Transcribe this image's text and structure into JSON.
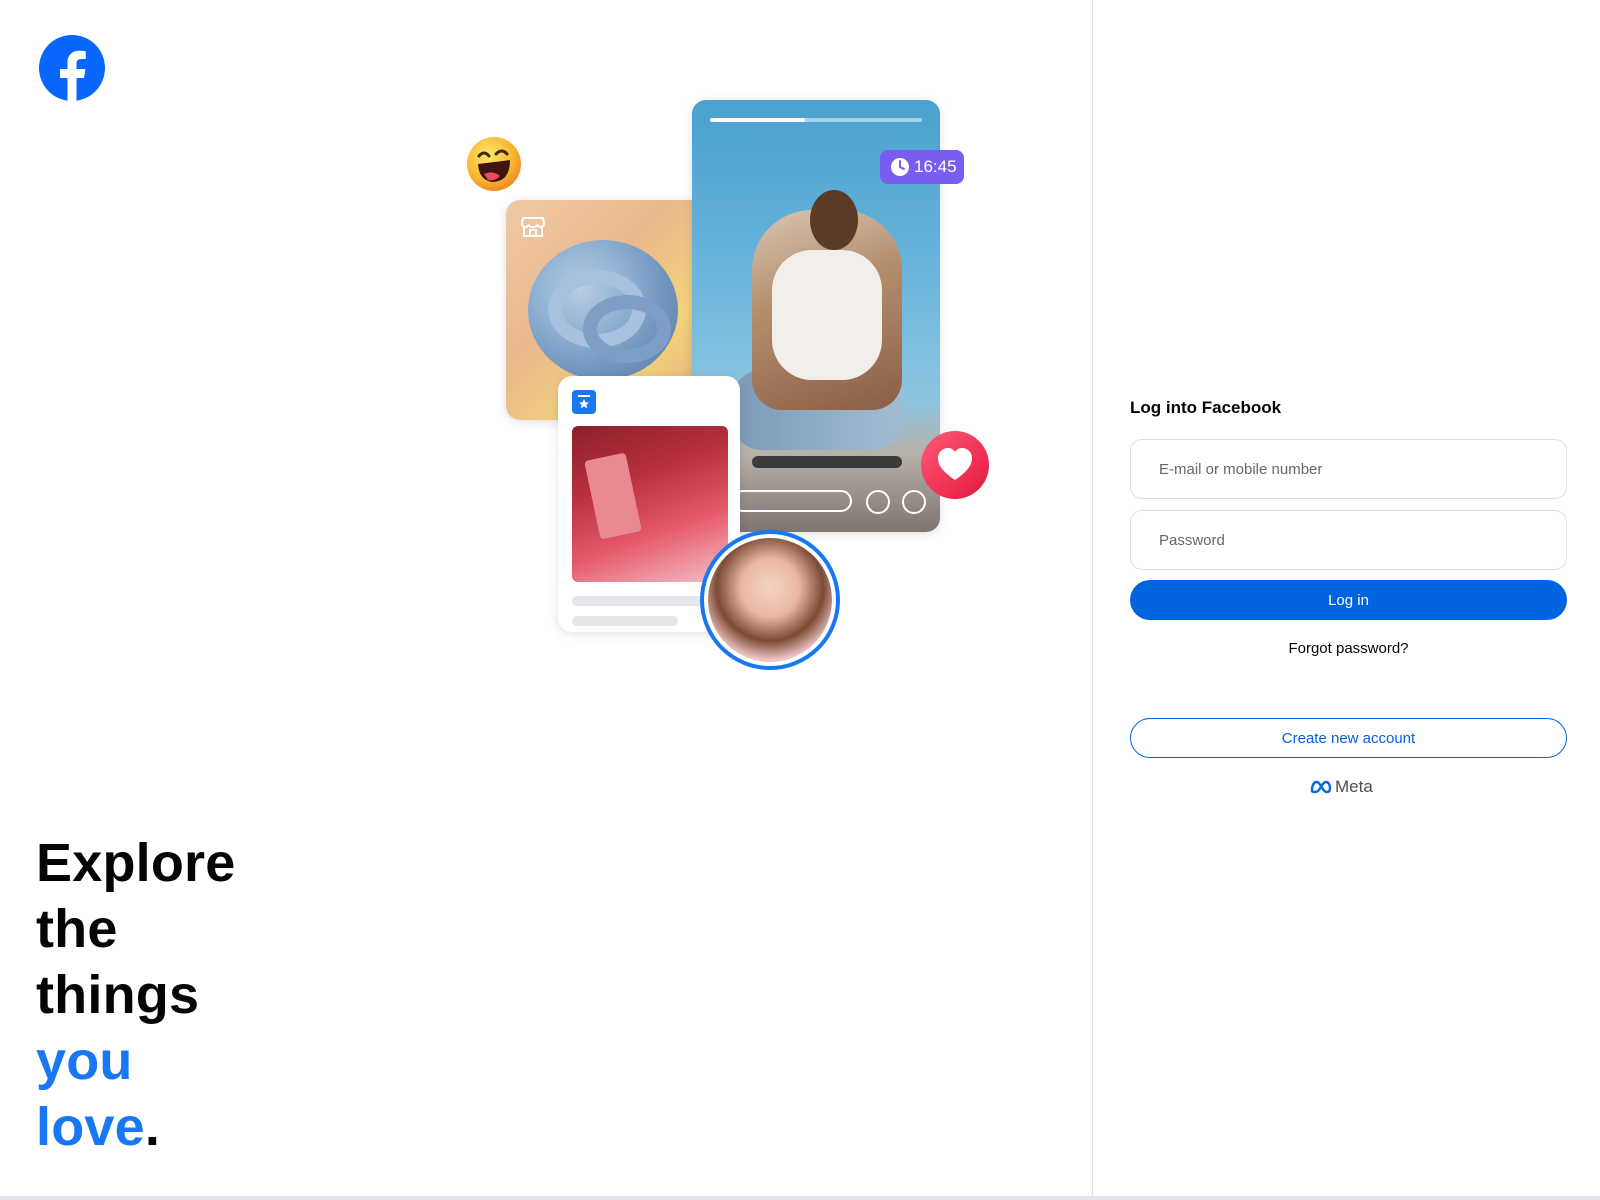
{
  "headline": {
    "line1": "Explore",
    "line2": "the",
    "line3": "things",
    "line4": "you",
    "line5": "love",
    "line5_punct": "."
  },
  "collage": {
    "timer_text": "16:45",
    "story_progress_percent": 45
  },
  "login": {
    "title": "Log into Facebook",
    "email_placeholder": "E-mail or mobile number",
    "password_placeholder": "Password",
    "login_button": "Log in",
    "forgot_password": "Forgot password?",
    "create_account_button": "Create new account",
    "meta_brand": "Meta"
  },
  "colors": {
    "facebook_blue": "#0866ff",
    "button_blue": "#0064e0",
    "headline_blue": "#1877f2",
    "heart_red": "#f02849",
    "timer_purple": "#7b5cf0"
  },
  "icons": {
    "logo": "facebook-logo-icon",
    "shop": "shop-icon",
    "bookmark": "bookmark-star-icon",
    "emoji": "laughing-emoji-icon",
    "heart": "heart-icon",
    "clock": "clock-icon",
    "meta": "meta-infinity-icon"
  }
}
